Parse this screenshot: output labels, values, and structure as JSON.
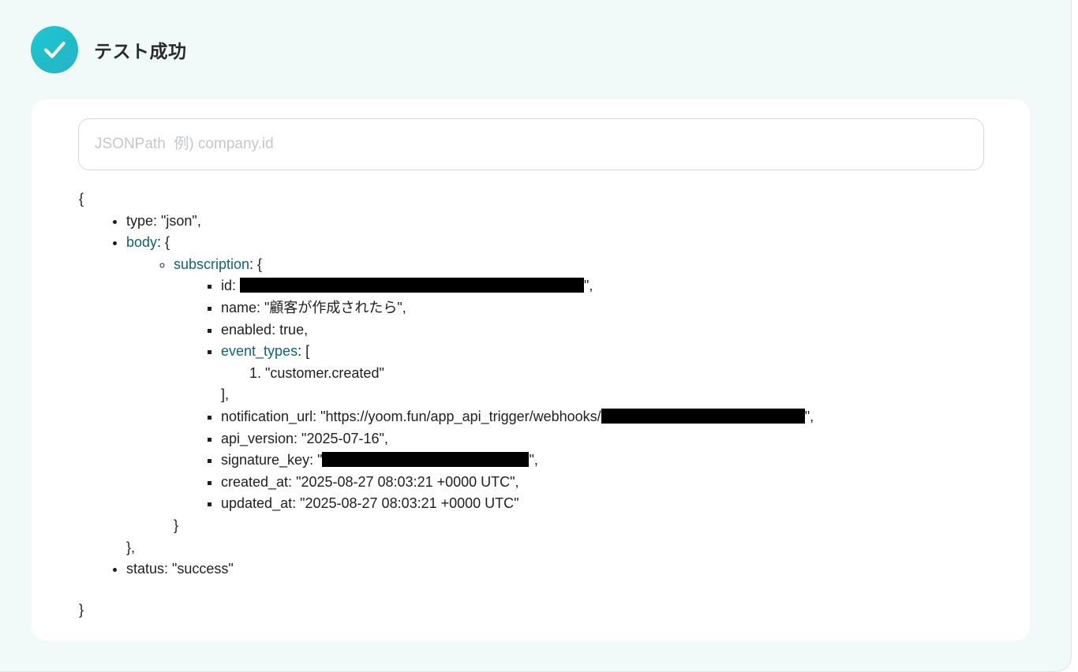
{
  "header": {
    "title": "テスト成功",
    "icon": "check-circle-icon"
  },
  "search": {
    "placeholder": "JSONPath  例) company.id"
  },
  "json": {
    "open_brace": "{",
    "close_brace": "}",
    "type_line": "type: \"json\",",
    "body_key": "body",
    "body_open": ": {",
    "subscription_key": "subscription",
    "subscription_open": ": {",
    "id_prefix": "id: ",
    "id_suffix": "\",",
    "name_line": "name: \"顧客が作成されたら\",",
    "enabled_line": "enabled: true,",
    "event_types_key": "event_types",
    "event_types_open": ": [",
    "event_type_item": "\"customer.created\"",
    "event_types_close": "],",
    "notification_prefix": "notification_url: \"https://yoom.fun/app_api_trigger/webhooks/",
    "notification_suffix": "\",",
    "api_version_line": "api_version: \"2025-07-16\",",
    "signature_prefix": "signature_key: \"",
    "signature_suffix": "\",",
    "created_at_line": "created_at: \"2025-08-27 08:03:21 +0000 UTC\",",
    "updated_at_line": "updated_at: \"2025-08-27 08:03:21 +0000 UTC\"",
    "subscription_close": "}",
    "body_close": "},",
    "status_line": "status: \"success\""
  },
  "colors": {
    "background": "#f1f9f9",
    "card": "#ffffff",
    "accent": "#1cc9d6",
    "key_link": "#0f6472"
  }
}
